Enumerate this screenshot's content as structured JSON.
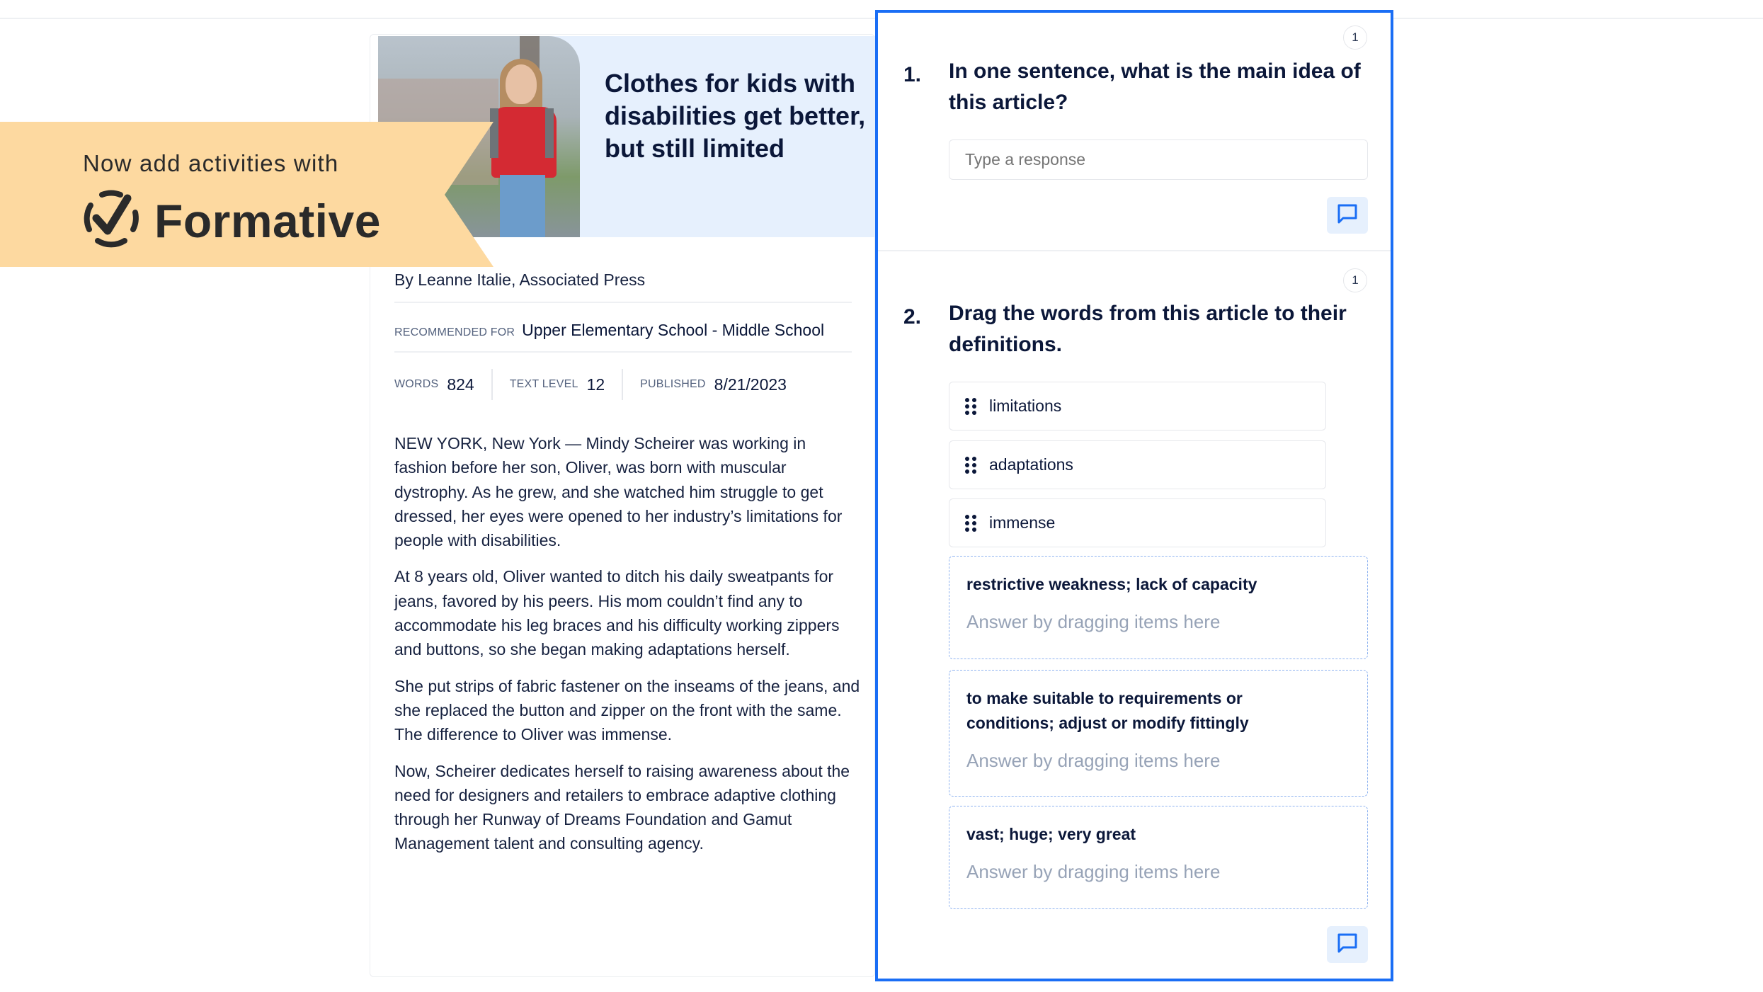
{
  "promo": {
    "subtitle": "Now add activities with",
    "brand": "Formative",
    "logo_icon": "check-circle-icon",
    "background_color": "#FDD9A0"
  },
  "article": {
    "title": "Clothes for kids with disabilities get better, but still limited",
    "photo_alt": "Teen girl with backpack walking beside a child in a wheelchair",
    "byline": "By Leanne Italie, Associated Press",
    "recommended_label": "RECOMMENDED FOR",
    "recommended_value": "Upper Elementary School - Middle School",
    "meta": [
      {
        "label": "WORDS",
        "value": "824"
      },
      {
        "label": "TEXT LEVEL",
        "value": "12"
      },
      {
        "label": "PUBLISHED",
        "value": "8/21/2023"
      }
    ],
    "paragraphs": [
      "NEW YORK, New York — Mindy Scheirer was working in fashion before her son, Oliver, was born with muscular dystrophy. As he grew, and she watched him struggle to get dressed, her eyes were opened to her industry’s limitations for people with disabilities.",
      "At 8 years old, Oliver wanted to ditch his daily sweatpants for jeans, favored by his peers. His mom couldn’t find any to accommodate his leg braces and his difficulty working zippers and buttons, so she began making adaptations herself.",
      "She put strips of fabric fastener on the inseams of the jeans, and she replaced the button and zipper on the front with the same. The difference to Oliver was immense.",
      "Now, Scheirer dedicates herself to raising awareness about the need for designers and retailers to embrace adaptive clothing through her Runway of Dreams Foundation and Gamut Management talent and consulting agency."
    ]
  },
  "questions": [
    {
      "number": "1.",
      "points": "1",
      "title": "In one sentence, what is the main idea of this article?",
      "response_placeholder": "Type a response",
      "comment_icon": "comment-icon"
    },
    {
      "number": "2.",
      "points": "1",
      "title": "Drag the words from this article to their definitions.",
      "drag_items": [
        "limitations",
        "adaptations",
        "immense"
      ],
      "drop_zones": [
        {
          "definition": "restrictive weakness; lack of capacity",
          "hint": "Answer by dragging items here"
        },
        {
          "definition": "to make suitable to requirements or conditions; adjust or modify fittingly",
          "hint": "Answer by dragging items here"
        },
        {
          "definition": "vast; huge; very great",
          "hint": "Answer by dragging items here"
        }
      ],
      "comment_icon": "comment-icon"
    }
  ],
  "colors": {
    "accent": "#1A6EF5",
    "header_bg": "#E6F0FD",
    "text": "#0B1739",
    "hint": "#97A3B7"
  }
}
